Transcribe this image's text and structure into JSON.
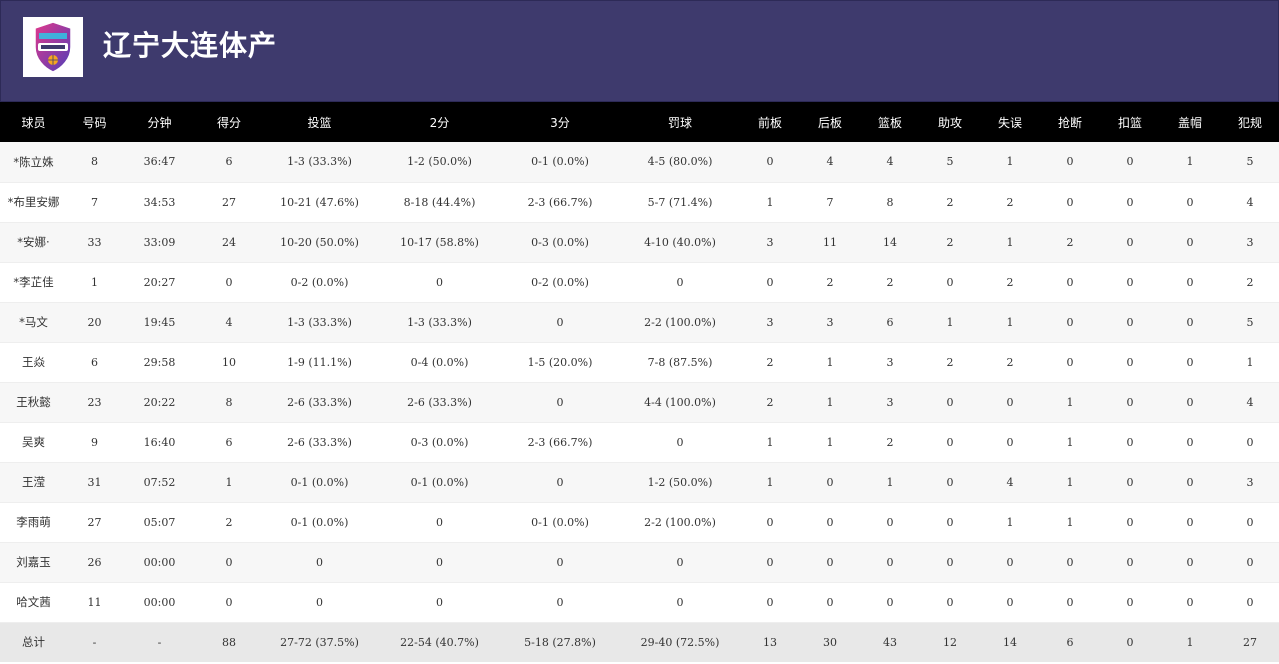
{
  "header": {
    "team_name": "辽宁大连体产",
    "logo_icon": "liaoning-basketball-logo",
    "bg_color": "#3e3a6d"
  },
  "columns": [
    "球员",
    "号码",
    "分钟",
    "得分",
    "投篮",
    "2分",
    "3分",
    "罚球",
    "前板",
    "后板",
    "篮板",
    "助攻",
    "失误",
    "抢断",
    "扣篮",
    "盖帽",
    "犯规"
  ],
  "rows": [
    [
      "*陈立姝",
      "8",
      "36:47",
      "6",
      "1-3 (33.3%)",
      "1-2 (50.0%)",
      "0-1 (0.0%)",
      "4-5 (80.0%)",
      "0",
      "4",
      "4",
      "5",
      "1",
      "0",
      "0",
      "1",
      "5"
    ],
    [
      "*布里安娜",
      "7",
      "34:53",
      "27",
      "10-21 (47.6%)",
      "8-18 (44.4%)",
      "2-3 (66.7%)",
      "5-7 (71.4%)",
      "1",
      "7",
      "8",
      "2",
      "2",
      "0",
      "0",
      "0",
      "4"
    ],
    [
      "*安娜·",
      "33",
      "33:09",
      "24",
      "10-20 (50.0%)",
      "10-17 (58.8%)",
      "0-3 (0.0%)",
      "4-10 (40.0%)",
      "3",
      "11",
      "14",
      "2",
      "1",
      "2",
      "0",
      "0",
      "3"
    ],
    [
      "*李芷佳",
      "1",
      "20:27",
      "0",
      "0-2 (0.0%)",
      "0",
      "0-2 (0.0%)",
      "0",
      "0",
      "2",
      "2",
      "0",
      "2",
      "0",
      "0",
      "0",
      "2"
    ],
    [
      "*马文",
      "20",
      "19:45",
      "4",
      "1-3 (33.3%)",
      "1-3 (33.3%)",
      "0",
      "2-2 (100.0%)",
      "3",
      "3",
      "6",
      "1",
      "1",
      "0",
      "0",
      "0",
      "5"
    ],
    [
      "王焱",
      "6",
      "29:58",
      "10",
      "1-9 (11.1%)",
      "0-4 (0.0%)",
      "1-5 (20.0%)",
      "7-8 (87.5%)",
      "2",
      "1",
      "3",
      "2",
      "2",
      "0",
      "0",
      "0",
      "1"
    ],
    [
      "王秋懿",
      "23",
      "20:22",
      "8",
      "2-6 (33.3%)",
      "2-6 (33.3%)",
      "0",
      "4-4 (100.0%)",
      "2",
      "1",
      "3",
      "0",
      "0",
      "1",
      "0",
      "0",
      "4"
    ],
    [
      "吴爽",
      "9",
      "16:40",
      "6",
      "2-6 (33.3%)",
      "0-3 (0.0%)",
      "2-3 (66.7%)",
      "0",
      "1",
      "1",
      "2",
      "0",
      "0",
      "1",
      "0",
      "0",
      "0"
    ],
    [
      "王滢",
      "31",
      "07:52",
      "1",
      "0-1 (0.0%)",
      "0-1 (0.0%)",
      "0",
      "1-2 (50.0%)",
      "1",
      "0",
      "1",
      "0",
      "4",
      "1",
      "0",
      "0",
      "3"
    ],
    [
      "李雨萌",
      "27",
      "05:07",
      "2",
      "0-1 (0.0%)",
      "0",
      "0-1 (0.0%)",
      "2-2 (100.0%)",
      "0",
      "0",
      "0",
      "0",
      "1",
      "1",
      "0",
      "0",
      "0"
    ],
    [
      "刘嘉玉",
      "26",
      "00:00",
      "0",
      "0",
      "0",
      "0",
      "0",
      "0",
      "0",
      "0",
      "0",
      "0",
      "0",
      "0",
      "0",
      "0"
    ],
    [
      "哈文茜",
      "11",
      "00:00",
      "0",
      "0",
      "0",
      "0",
      "0",
      "0",
      "0",
      "0",
      "0",
      "0",
      "0",
      "0",
      "0",
      "0"
    ]
  ],
  "total": [
    "总计",
    "-",
    "-",
    "88",
    "27-72 (37.5%)",
    "22-54 (40.7%)",
    "5-18 (27.8%)",
    "29-40 (72.5%)",
    "13",
    "30",
    "43",
    "12",
    "14",
    "6",
    "0",
    "1",
    "27"
  ]
}
